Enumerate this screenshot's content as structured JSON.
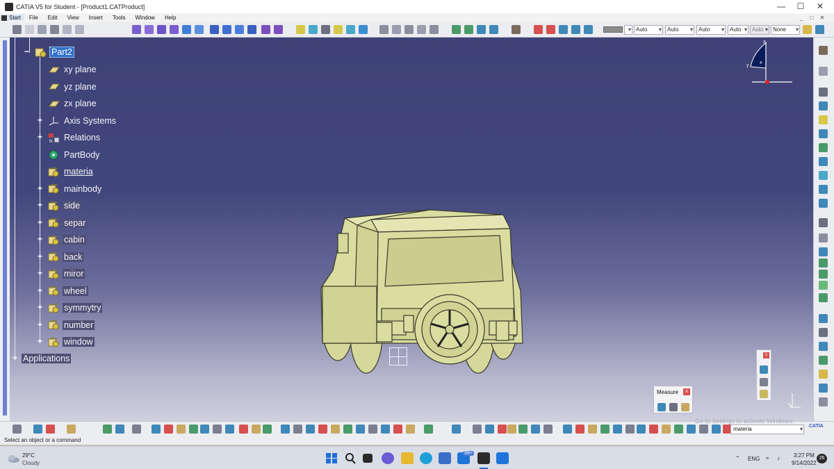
{
  "window": {
    "title": "CATIA V5 for Student - [Product1.CATProduct]",
    "minimize": "—",
    "maximize": "☐",
    "close": "✕"
  },
  "menu": {
    "start": "Start",
    "items": [
      "File",
      "Edit",
      "View",
      "Insert",
      "Tools",
      "Window",
      "Help"
    ]
  },
  "toolbar": {
    "line_type": "Auto",
    "line_weight": "Auto",
    "layer": "Auto",
    "render_mode": "Auto",
    "extra": "Auto",
    "filter": "None"
  },
  "tree": {
    "root_node": "Part2",
    "children": [
      {
        "label": "xy plane",
        "icon": "plane-icon"
      },
      {
        "label": "yz plane",
        "icon": "plane-icon"
      },
      {
        "label": "zx plane",
        "icon": "plane-icon"
      },
      {
        "label": "Axis Systems",
        "icon": "axis-icon"
      },
      {
        "label": "Relations",
        "icon": "relations-icon"
      },
      {
        "label": "PartBody",
        "icon": "partbody-icon"
      },
      {
        "label": "materia",
        "icon": "body-icon"
      },
      {
        "label": "mainbody",
        "icon": "body-icon"
      },
      {
        "label": "side",
        "icon": "body-icon"
      },
      {
        "label": "separ",
        "icon": "body-icon"
      },
      {
        "label": "cabin",
        "icon": "body-icon"
      },
      {
        "label": "back",
        "icon": "body-icon"
      },
      {
        "label": "miror",
        "icon": "body-icon"
      },
      {
        "label": "wheel",
        "icon": "body-icon"
      },
      {
        "label": "symmytry",
        "icon": "body-icon"
      },
      {
        "label": "number",
        "icon": "body-icon"
      },
      {
        "label": "window",
        "icon": "body-icon"
      }
    ],
    "applications": "Applications"
  },
  "compass": {
    "x": "x",
    "y": "y",
    "z": "z"
  },
  "measure_palette": {
    "title": "Measure",
    "close": "x"
  },
  "small_palette": {
    "close": "x"
  },
  "power_input": "materia",
  "status": "Select an object or a command",
  "watermark": "Go to Settings to activate Windows.",
  "catia_logo": "CATIA",
  "taskbar": {
    "temperature": "29°C",
    "weather": "Cloudy",
    "badge": "99+",
    "language": "ENG",
    "time": "3:27 PM",
    "date": "9/14/2022",
    "notifications": "26"
  }
}
